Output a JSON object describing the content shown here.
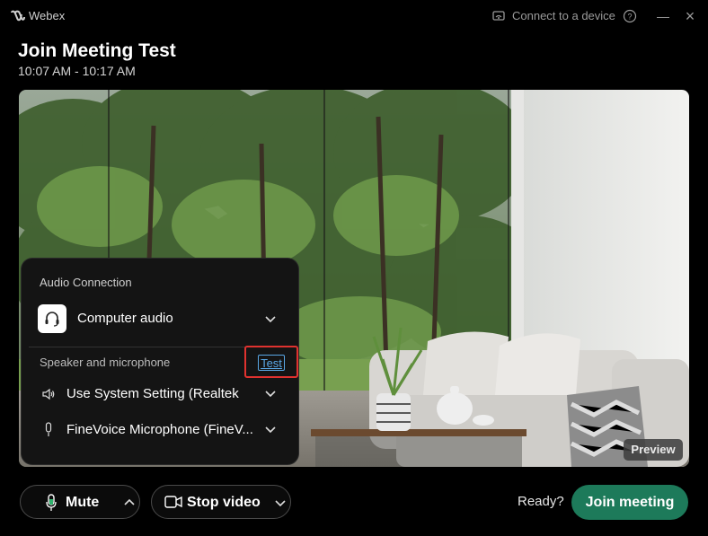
{
  "app": {
    "name": "Webex"
  },
  "titlebar": {
    "connect_label": "Connect to a device",
    "help": "?",
    "minimize": "—",
    "close": "×"
  },
  "meeting": {
    "title": "Join Meeting Test",
    "time": "10:07 AM - 10:17 AM"
  },
  "preview": {
    "badge": "Preview"
  },
  "audio_panel": {
    "title": "Audio Connection",
    "device": "Computer audio",
    "speaker_mic_label": "Speaker and microphone",
    "test_label": "Test",
    "speaker": "Use System Setting (Realtek",
    "microphone": "FineVoice Microphone (FineV..."
  },
  "controls": {
    "mute_label": "Mute",
    "stop_video_label": "Stop video",
    "ready_label": "Ready?",
    "join_label": "Join meeting"
  },
  "colors": {
    "accent_green": "#1d7a5a",
    "highlight_red": "#e0322f",
    "link_blue": "#5aa8e6"
  }
}
